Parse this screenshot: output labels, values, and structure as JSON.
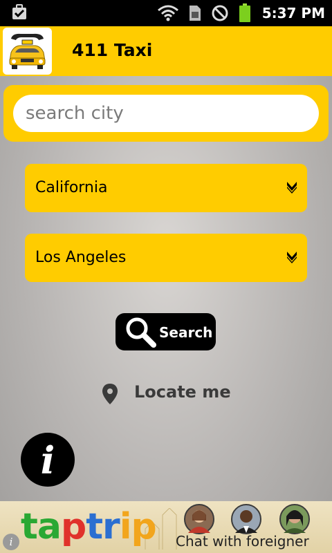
{
  "status_bar": {
    "time": "5:37 PM",
    "icons": [
      "briefcase-check-icon",
      "wifi-icon",
      "sim-card-icon",
      "no-sync-icon",
      "battery-icon"
    ]
  },
  "app_bar": {
    "title": "411 Taxi",
    "logo": "taxi-phone-logo"
  },
  "search": {
    "placeholder": "search city",
    "value": ""
  },
  "dropdowns": {
    "state": {
      "selected": "California",
      "icon": "chevron-down-icon"
    },
    "city": {
      "selected": "Los Angeles",
      "icon": "chevron-down-icon"
    }
  },
  "search_button": {
    "label": "Search",
    "icon": "magnifier-icon"
  },
  "locate": {
    "label": "Locate me",
    "icon": "location-pin-icon"
  },
  "info_button": {
    "glyph": "i"
  },
  "ad": {
    "brand_parts": [
      "ta",
      "p",
      "tr",
      "ip"
    ],
    "tagline": "Chat with foreigner",
    "info_glyph": "i"
  },
  "colors": {
    "accent": "#ffcc00",
    "background": "#c8c5c2",
    "button": "#000000"
  }
}
